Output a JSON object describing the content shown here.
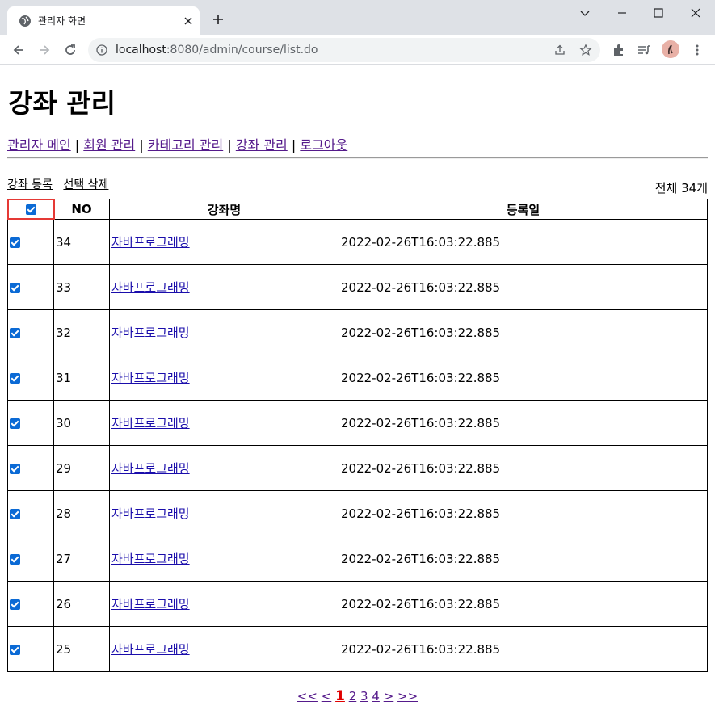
{
  "browser": {
    "tab_title": "관리자 화면",
    "url_host": "localhost",
    "url_rest": ":8080/admin/course/list.do"
  },
  "page": {
    "title": "강좌 관리",
    "nav": [
      {
        "label": "관리자 메인"
      },
      {
        "label": "회원 관리"
      },
      {
        "label": "카테고리 관리"
      },
      {
        "label": "강좌 관리"
      },
      {
        "label": "로그아웃"
      }
    ],
    "nav_separator": "|",
    "actions": {
      "register": "강좌 등록",
      "delete_selected": "선택 삭제"
    },
    "total": "전체 34개"
  },
  "table": {
    "headers": {
      "no": "NO",
      "name": "강좌명",
      "date": "등록일"
    },
    "rows": [
      {
        "no": "34",
        "name": "자바프로그래밍",
        "date": "2022-02-26T16:03:22.885",
        "checked": true
      },
      {
        "no": "33",
        "name": "자바프로그래밍",
        "date": "2022-02-26T16:03:22.885",
        "checked": true
      },
      {
        "no": "32",
        "name": "자바프로그래밍",
        "date": "2022-02-26T16:03:22.885",
        "checked": true
      },
      {
        "no": "31",
        "name": "자바프로그래밍",
        "date": "2022-02-26T16:03:22.885",
        "checked": true
      },
      {
        "no": "30",
        "name": "자바프로그래밍",
        "date": "2022-02-26T16:03:22.885",
        "checked": true
      },
      {
        "no": "29",
        "name": "자바프로그래밍",
        "date": "2022-02-26T16:03:22.885",
        "checked": true
      },
      {
        "no": "28",
        "name": "자바프로그래밍",
        "date": "2022-02-26T16:03:22.885",
        "checked": true
      },
      {
        "no": "27",
        "name": "자바프로그래밍",
        "date": "2022-02-26T16:03:22.885",
        "checked": true
      },
      {
        "no": "26",
        "name": "자바프로그래밍",
        "date": "2022-02-26T16:03:22.885",
        "checked": true
      },
      {
        "no": "25",
        "name": "자바프로그래밍",
        "date": "2022-02-26T16:03:22.885",
        "checked": true
      }
    ]
  },
  "pager": {
    "first": "<<",
    "prev": "<",
    "pages": [
      "1",
      "2",
      "3",
      "4"
    ],
    "current": "1",
    "next": ">",
    "last": ">>"
  },
  "colors": {
    "checkbox": "#0b6ad5",
    "highlight": "#e53935",
    "visited_link": "#551a8b",
    "current_page": "#e00000"
  }
}
